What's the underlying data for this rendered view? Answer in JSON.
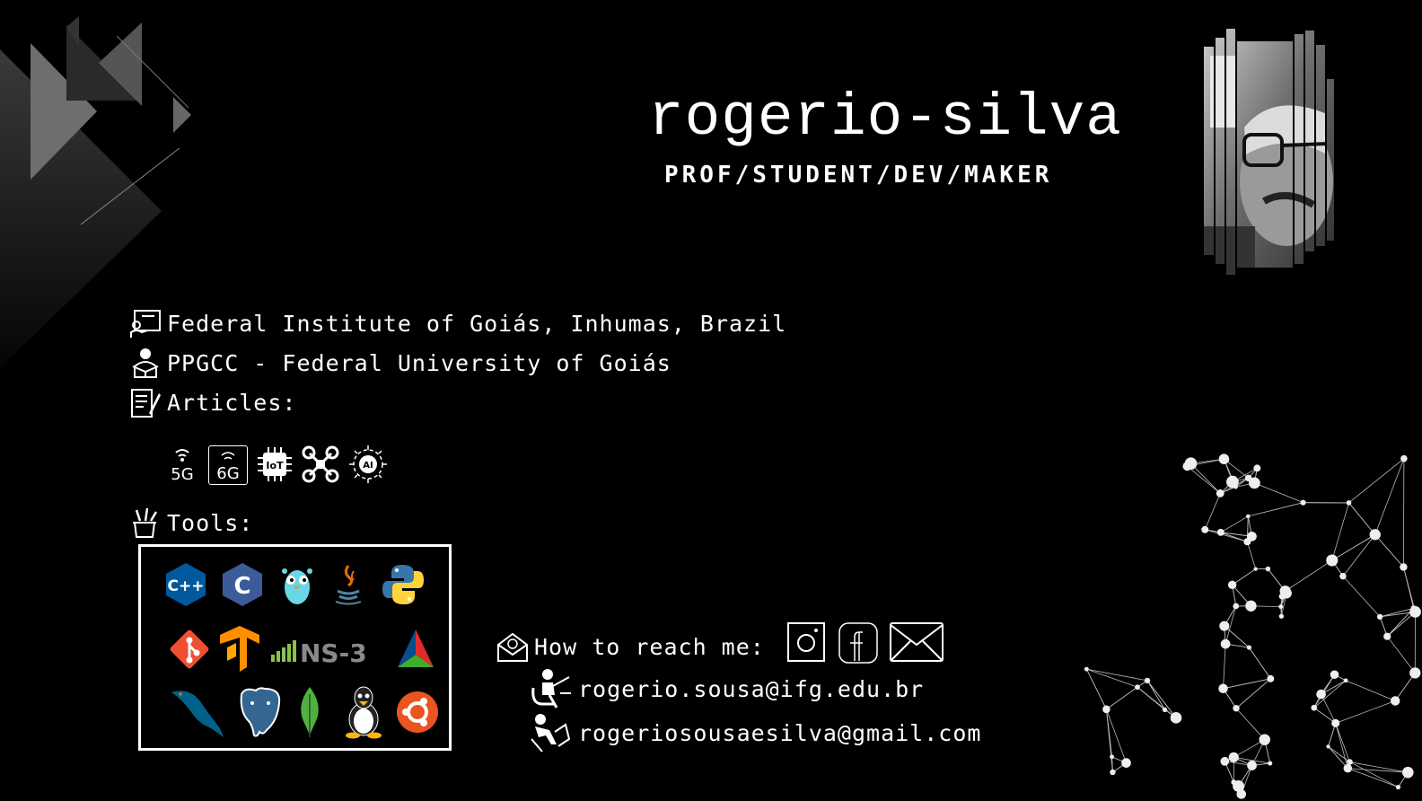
{
  "header": {
    "name": "rogerio-silva",
    "tagline": "PROF/STUDENT/DEV/MAKER"
  },
  "info": {
    "institute": "Federal Institute of Goiás, Inhumas, Brazil",
    "program": "PPGCC - Federal University of Goiás",
    "articles_label": "Articles:",
    "tools_label": "Tools:"
  },
  "topics": {
    "fiveg": "5G",
    "sixg": "6G",
    "iot": "IoT",
    "ai": "AI"
  },
  "tools": {
    "cpp": "C++",
    "c": "C",
    "ns3": "NS-3"
  },
  "contact": {
    "label": "How to reach me:",
    "email_work": "rogerio.sousa@ifg.edu.br",
    "email_personal": "rogeriosousaesilva@gmail.com"
  },
  "icons": [
    "certificate-icon",
    "student-icon",
    "article-icon",
    "5g-icon",
    "6g-icon",
    "iot-chip-icon",
    "drone-icon",
    "ai-icon",
    "tools-icon",
    "cpp-logo-icon",
    "c-logo-icon",
    "gopher-icon",
    "java-icon",
    "python-icon",
    "git-icon",
    "tensorflow-icon",
    "ns3-logo-icon",
    "cmake-icon",
    "mysql-icon",
    "postgresql-icon",
    "mongodb-icon",
    "linux-tux-icon",
    "ubuntu-icon",
    "mail-envelope-icon",
    "instagram-icon",
    "facebook-icon",
    "email-icon",
    "teacher-icon",
    "reading-person-icon"
  ],
  "colors": {
    "background": "#000000",
    "text": "#ffffff"
  }
}
